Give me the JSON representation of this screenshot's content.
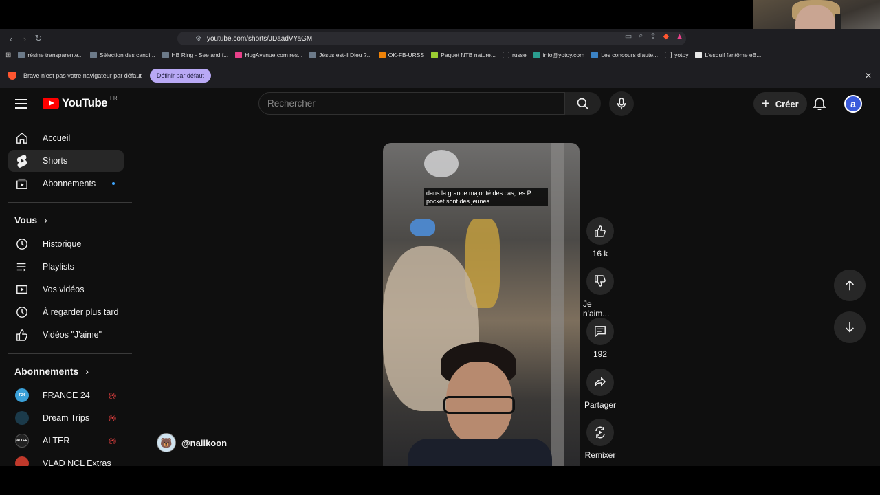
{
  "browser": {
    "url": "youtube.com/shorts/JDaadVYaGM",
    "bookmarks": [
      {
        "label": "résine transparente..."
      },
      {
        "label": "Sélection des candi..."
      },
      {
        "label": "HB Ring - See and f..."
      },
      {
        "label": "HugAvenue.com res..."
      },
      {
        "label": "Jésus est-il Dieu ?..."
      },
      {
        "label": "OK-FB-URSS"
      },
      {
        "label": "Paquet NTB nature..."
      },
      {
        "label": "russe"
      },
      {
        "label": "info@yotoy.com"
      },
      {
        "label": "Les concours d'aute..."
      },
      {
        "label": "yotoy"
      },
      {
        "label": "L'esquif fantôme eB..."
      }
    ],
    "infobar": {
      "message": "Brave n'est pas votre navigateur par défaut",
      "button": "Définir par défaut"
    }
  },
  "youtube": {
    "logo_text": "YouTube",
    "region": "FR",
    "search_placeholder": "Rechercher",
    "create_label": "Créer",
    "avatar_letter": "a"
  },
  "sidebar": {
    "main": [
      {
        "label": "Accueil"
      },
      {
        "label": "Shorts"
      },
      {
        "label": "Abonnements"
      }
    ],
    "you_header": "Vous",
    "you": [
      {
        "label": "Historique"
      },
      {
        "label": "Playlists"
      },
      {
        "label": "Vos vidéos"
      },
      {
        "label": "À regarder plus tard"
      },
      {
        "label": "Vidéos \"J'aime\""
      }
    ],
    "subs_header": "Abonnements",
    "subs": [
      {
        "label": "FRANCE 24",
        "color": "#3aa0d8"
      },
      {
        "label": "Dream Trips",
        "color": "#1b3a4a"
      },
      {
        "label": "ALTER",
        "color": "#222222"
      },
      {
        "label": "VLAD NCL Extras",
        "color": "#c0392b"
      }
    ]
  },
  "short": {
    "caption": "dans la grande majorité des cas, les P pocket sont des jeunes",
    "channel": "@naiikoon",
    "likes": "16 k",
    "dislike_label": "Je n'aim...",
    "comments": "192",
    "share_label": "Partager",
    "remix_label": "Remixer"
  }
}
